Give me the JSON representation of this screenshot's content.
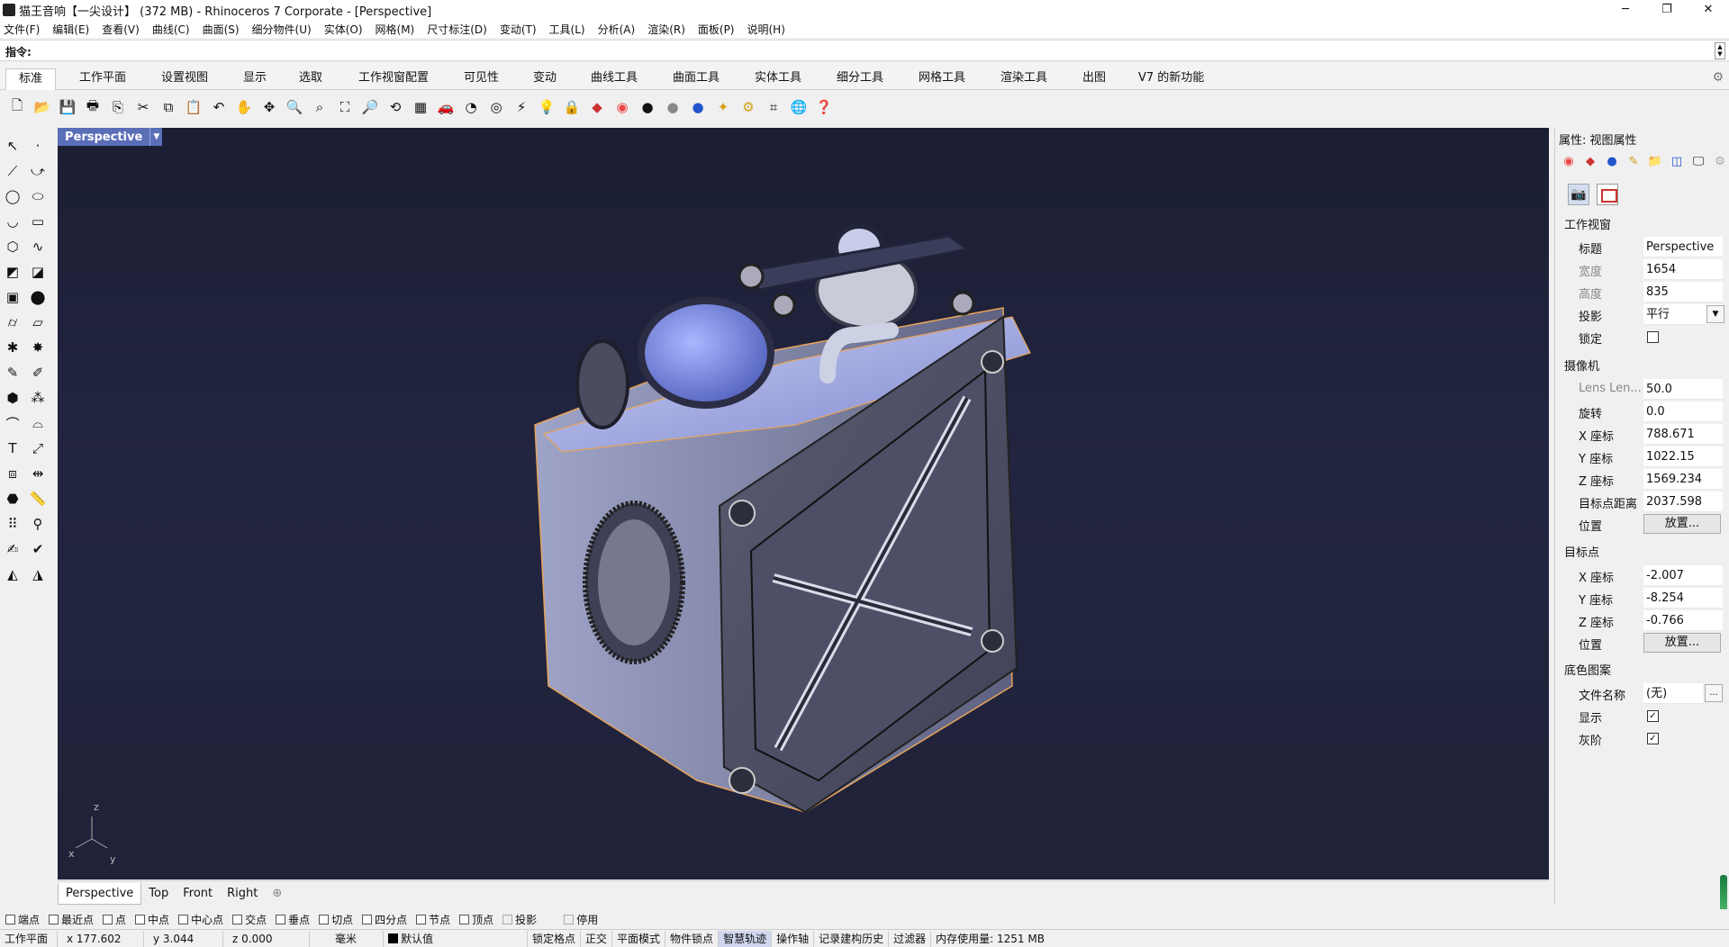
{
  "window": {
    "title": "猫王音响【一尖设计】 (372 MB) - Rhinoceros 7 Corporate - [Perspective]",
    "min": "─",
    "max": "❐",
    "close": "✕"
  },
  "menu": [
    "文件(F)",
    "编辑(E)",
    "查看(V)",
    "曲线(C)",
    "曲面(S)",
    "细分物件(U)",
    "实体(O)",
    "网格(M)",
    "尺寸标注(D)",
    "变动(T)",
    "工具(L)",
    "分析(A)",
    "渲染(R)",
    "面板(P)",
    "说明(H)"
  ],
  "command": {
    "label": "指令:",
    "value": ""
  },
  "tabs": [
    "标准",
    "工作平面",
    "设置视图",
    "显示",
    "选取",
    "工作视窗配置",
    "可见性",
    "变动",
    "曲线工具",
    "曲面工具",
    "实体工具",
    "细分工具",
    "网格工具",
    "渲染工具",
    "出图",
    "V7 的新功能"
  ],
  "viewport": {
    "label": "Perspective",
    "axis_z": "z",
    "axis_x": "x",
    "axis_y": "y"
  },
  "view_tabs": [
    "Perspective",
    "Top",
    "Front",
    "Right",
    "⊕"
  ],
  "osnaps": [
    {
      "label": "端点",
      "checked": false,
      "disabled": false
    },
    {
      "label": "最近点",
      "checked": false,
      "disabled": false
    },
    {
      "label": "点",
      "checked": false,
      "disabled": false
    },
    {
      "label": "中点",
      "checked": false,
      "disabled": false
    },
    {
      "label": "中心点",
      "checked": false,
      "disabled": false
    },
    {
      "label": "交点",
      "checked": false,
      "disabled": false
    },
    {
      "label": "垂点",
      "checked": false,
      "disabled": false
    },
    {
      "label": "切点",
      "checked": false,
      "disabled": false
    },
    {
      "label": "四分点",
      "checked": false,
      "disabled": false
    },
    {
      "label": "节点",
      "checked": false,
      "disabled": false
    },
    {
      "label": "顶点",
      "checked": false,
      "disabled": false
    },
    {
      "label": "投影",
      "checked": false,
      "disabled": true
    },
    {
      "label": "停用",
      "checked": false,
      "disabled": true
    }
  ],
  "status": {
    "cplane": "工作平面",
    "x": "x 177.602",
    "y": "y 3.044",
    "z": "z 0.000",
    "unit": "毫米",
    "layer": "默认值",
    "items": [
      "锁定格点",
      "正交",
      "平面模式",
      "物件锁点",
      "智慧轨迹",
      "操作轴",
      "记录建构历史",
      "过滤器",
      "内存使用量: 1251 MB"
    ],
    "highlighted": "智慧轨迹"
  },
  "panel": {
    "title": "属性: 视图属性",
    "viewport_section": "工作视窗",
    "title_k": "标题",
    "title_v": "Perspective",
    "width_k": "宽度",
    "width_v": "1654",
    "height_k": "高度",
    "height_v": "835",
    "proj_k": "投影",
    "proj_v": "平行",
    "lock_k": "锁定",
    "camera_section": "摄像机",
    "lens_k": "Lens Len...",
    "lens_v": "50.0",
    "rot_k": "旋转",
    "rot_v": "0.0",
    "cx_k": "X 座标",
    "cx_v": "788.671",
    "cy_k": "Y 座标",
    "cy_v": "1022.15",
    "cz_k": "Z 座标",
    "cz_v": "1569.234",
    "dist_k": "目标点距离",
    "dist_v": "2037.598",
    "pos_k": "位置",
    "pos_btn": "放置...",
    "target_section": "目标点",
    "tx_k": "X 座标",
    "tx_v": "-2.007",
    "ty_k": "Y 座标",
    "ty_v": "-8.254",
    "tz_k": "Z 座标",
    "tz_v": "-0.766",
    "tpos_k": "位置",
    "tpos_btn": "放置...",
    "bg_section": "底色图案",
    "file_k": "文件名称",
    "file_v": "(无)",
    "file_btn": "...",
    "show_k": "显示",
    "gray_k": "灰阶"
  }
}
